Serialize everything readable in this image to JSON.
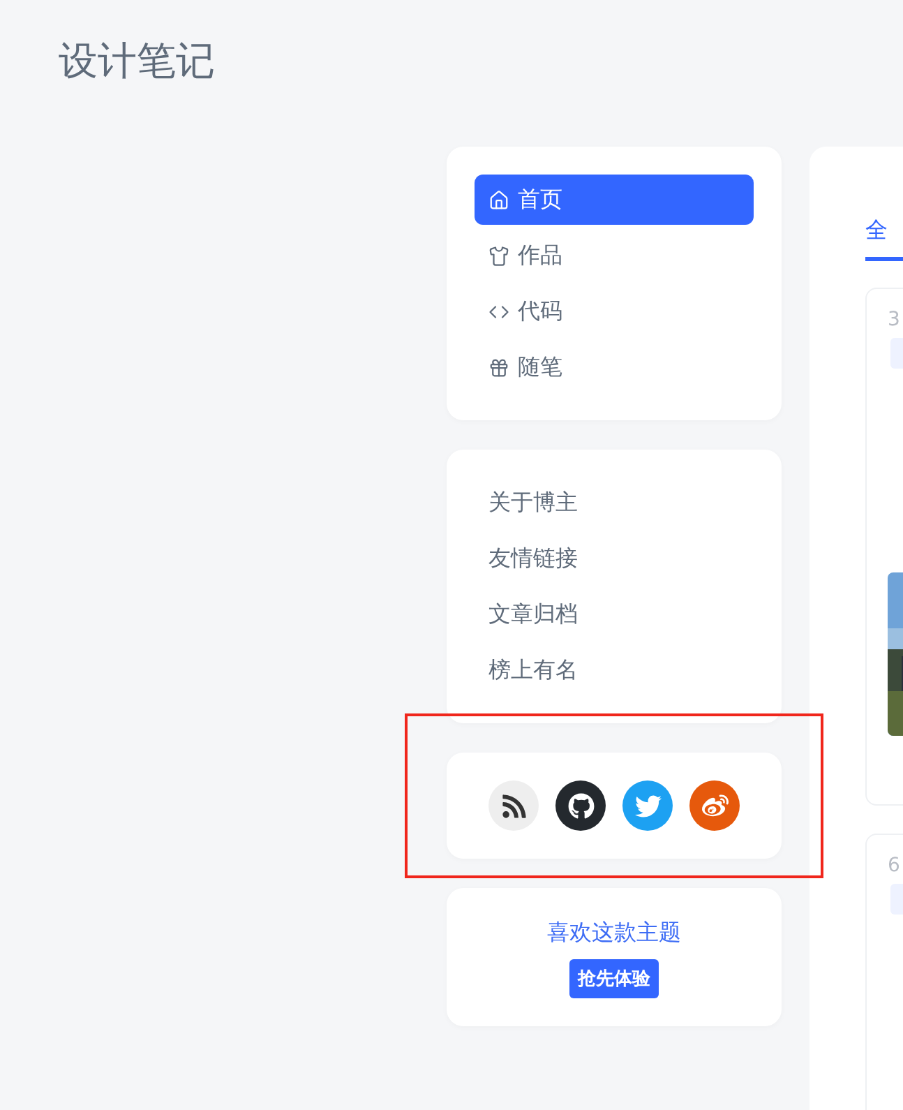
{
  "site_title": "设计笔记",
  "nav": [
    {
      "label": "首页",
      "selected": true
    },
    {
      "label": "作品",
      "selected": false
    },
    {
      "label": "代码",
      "selected": false
    },
    {
      "label": "随笔",
      "selected": false
    }
  ],
  "links": [
    "关于博主",
    "友情链接",
    "文章归档",
    "榜上有名"
  ],
  "social": [
    {
      "kind": "rss"
    },
    {
      "kind": "github"
    },
    {
      "kind": "twitter"
    },
    {
      "kind": "weibo"
    }
  ],
  "promo": {
    "text": "喜欢这款主题",
    "button": "抢先体验"
  },
  "tabs": [
    {
      "label": "全",
      "selected": true
    }
  ],
  "posts": [
    {
      "date": "3"
    },
    {
      "date": "6"
    }
  ]
}
